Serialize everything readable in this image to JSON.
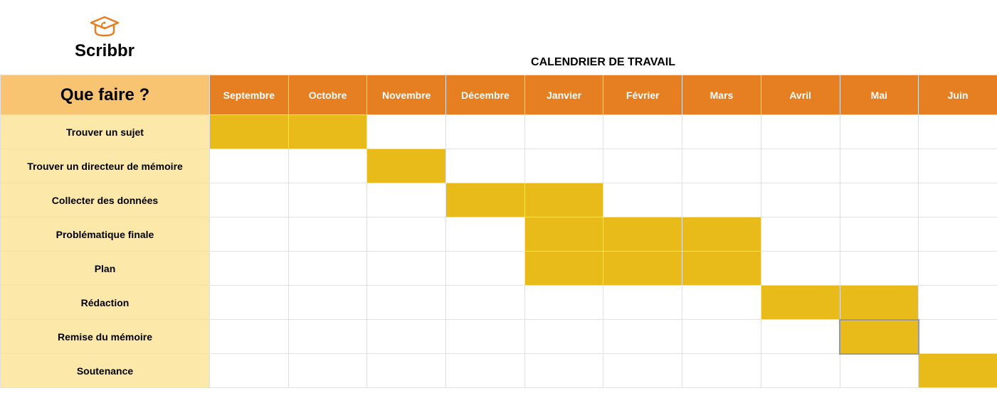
{
  "logo": {
    "text": "Scribbr"
  },
  "title": "CALENDRIER DE TRAVAIL",
  "corner_label": "Que faire ?",
  "months": [
    "Septembre",
    "Octobre",
    "Novembre",
    "Décembre",
    "Janvier",
    "Février",
    "Mars",
    "Avril",
    "Mai",
    "Juin"
  ],
  "tasks": [
    "Trouver un sujet",
    "Trouver un directeur de mémoire",
    "Collecter des données",
    "Problématique finale",
    "Plan",
    "Rédaction",
    "Remise du mémoire",
    "Soutenance"
  ],
  "chart_data": {
    "type": "bar",
    "orientation": "gantt",
    "title": "CALENDRIER DE TRAVAIL",
    "xlabel": "",
    "ylabel": "Que faire ?",
    "categories": [
      "Septembre",
      "Octobre",
      "Novembre",
      "Décembre",
      "Janvier",
      "Février",
      "Mars",
      "Avril",
      "Mai",
      "Juin"
    ],
    "series": [
      {
        "name": "Trouver un sujet",
        "start": "Septembre",
        "end": "Octobre",
        "range_index": [
          0,
          1
        ]
      },
      {
        "name": "Trouver un directeur de mémoire",
        "start": "Novembre",
        "end": "Novembre",
        "range_index": [
          2,
          2
        ]
      },
      {
        "name": "Collecter des données",
        "start": "Décembre",
        "end": "Janvier",
        "range_index": [
          3,
          4
        ]
      },
      {
        "name": "Problématique finale",
        "start": "Janvier",
        "end": "Mars",
        "range_index": [
          4,
          6
        ]
      },
      {
        "name": "Plan",
        "start": "Janvier",
        "end": "Mars",
        "range_index": [
          4,
          6
        ]
      },
      {
        "name": "Rédaction",
        "start": "Avril",
        "end": "Mai",
        "range_index": [
          7,
          8
        ]
      },
      {
        "name": "Remise du mémoire",
        "start": "Mai",
        "end": "Mai",
        "range_index": [
          8,
          8
        ],
        "selected": true
      },
      {
        "name": "Soutenance",
        "start": "Juin",
        "end": "Juin",
        "range_index": [
          9,
          9
        ]
      }
    ],
    "colors": {
      "bar": "#e8ba1a",
      "header": "#e67e22",
      "label_bg": "#fce8a8",
      "corner_bg": "#f8c471"
    }
  }
}
